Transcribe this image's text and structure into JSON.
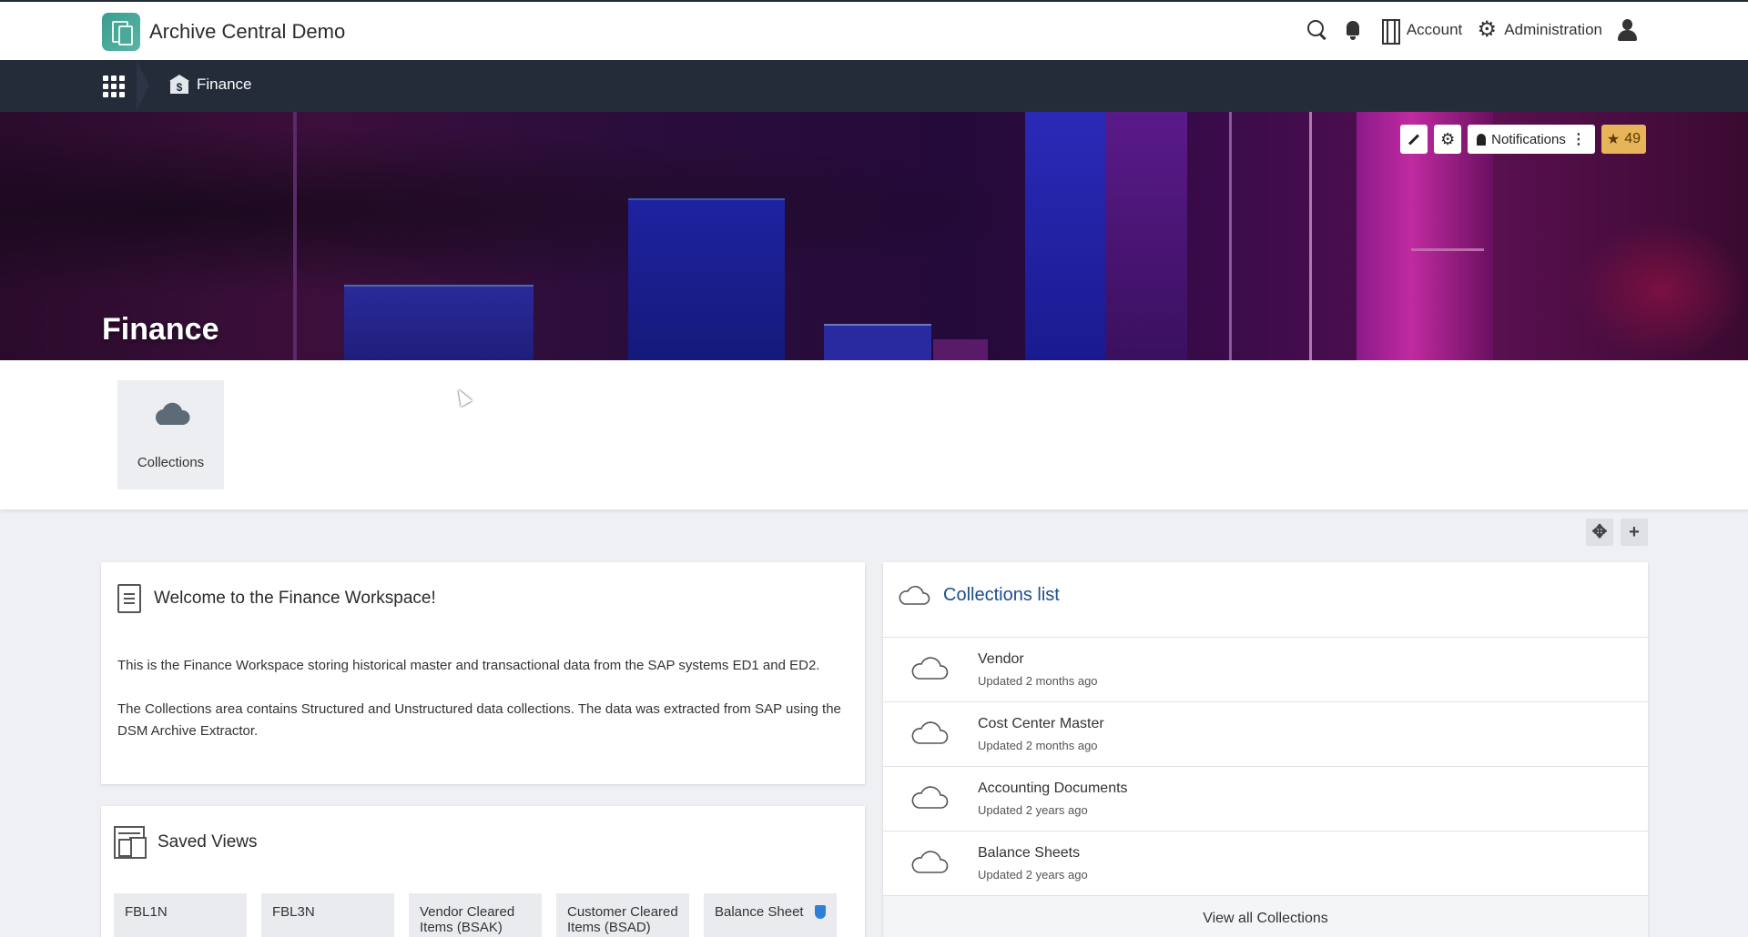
{
  "app": {
    "title": "Archive Central Demo"
  },
  "top_actions": {
    "account_label": "Account",
    "administration_label": "Administration"
  },
  "breadcrumb": {
    "current": "Finance"
  },
  "hero": {
    "title": "Finance",
    "notifications_label": "Notifications",
    "favorites_count": "49"
  },
  "tiles": [
    {
      "label": "Collections",
      "icon": "cloud-icon"
    }
  ],
  "welcome": {
    "title": "Welcome to the Finance Workspace!",
    "paragraph1": "This is the Finance Workspace storing historical master and transactional data from the SAP systems ED1 and ED2.",
    "paragraph2": "The Collections area contains Structured and Unstructured data collections. The data was extracted from SAP using the DSM Archive Extractor."
  },
  "saved_views": {
    "title": "Saved Views",
    "items": [
      {
        "label": "FBL1N"
      },
      {
        "label": "FBL3N"
      },
      {
        "label": "Vendor Cleared Items (BSAK)"
      },
      {
        "label": "Customer Cleared Items (BSAD)"
      },
      {
        "label": "Balance Sheet"
      }
    ]
  },
  "collections": {
    "title": "Collections list",
    "items": [
      {
        "name": "Vendor",
        "updated": "Updated 2 months ago"
      },
      {
        "name": "Cost Center Master",
        "updated": "Updated 2 months ago"
      },
      {
        "name": "Accounting Documents",
        "updated": "Updated 2 years ago"
      },
      {
        "name": "Balance Sheets",
        "updated": "Updated 2 years ago"
      }
    ],
    "view_all_label": "View all Collections"
  },
  "colors": {
    "nav_bg": "#242c3a",
    "link_blue": "#1e4e8c",
    "favorite_badge": "#e8b45a",
    "shield_blue": "#2f7fd8"
  }
}
